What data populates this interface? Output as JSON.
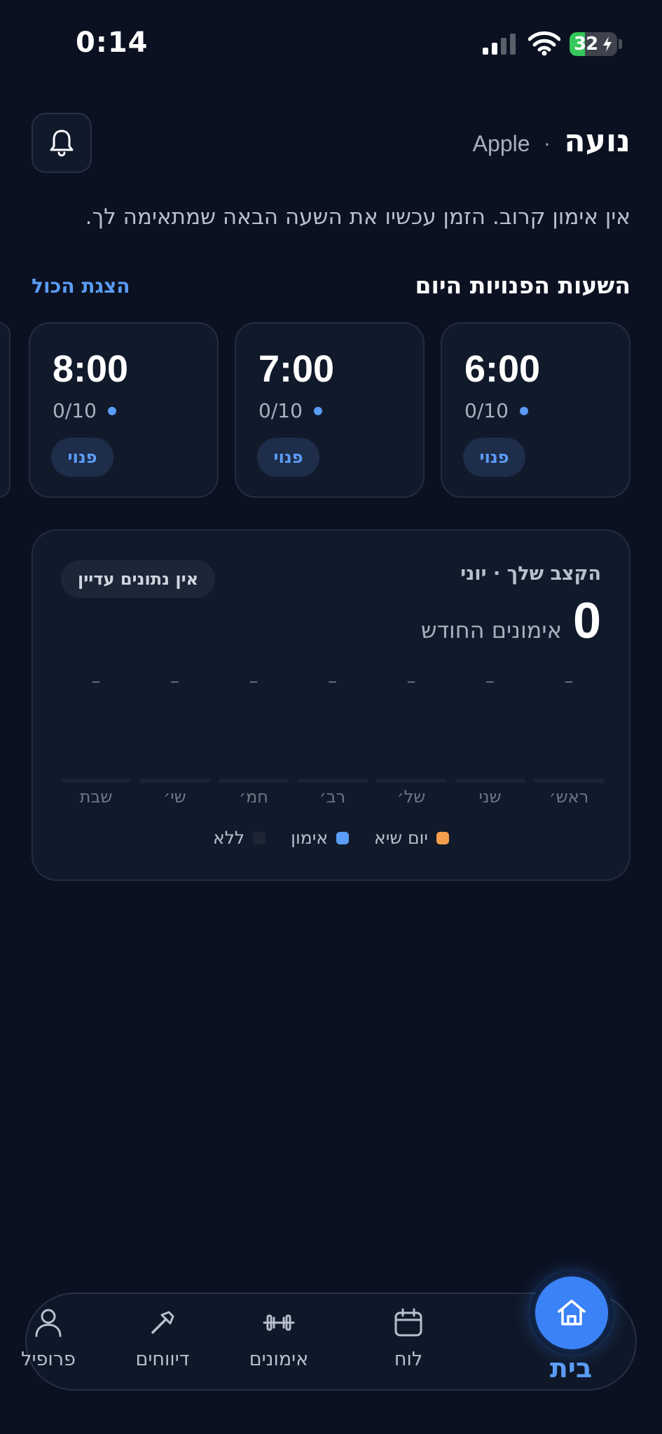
{
  "status_bar": {
    "time": "0:14",
    "battery_level": "32",
    "battery_color": "#34c759",
    "icons": [
      "signal-icon",
      "wifi-icon",
      "battery-charging-icon"
    ]
  },
  "header": {
    "user_name": "נועה",
    "separator": "·",
    "brand": "Apple",
    "bell_icon": "bell-icon",
    "subtitle": "אין אימון קרוב. הזמן עכשיו את השעה הבאה שמתאימה לך."
  },
  "free_slots": {
    "title": "השעות הפנויות היום",
    "show_all_label": "הצגת הכול",
    "items": [
      {
        "time": "6:00",
        "capacity": "0/10",
        "status": "פנוי"
      },
      {
        "time": "7:00",
        "capacity": "0/10",
        "status": "פנוי"
      },
      {
        "time": "8:00",
        "capacity": "0/10",
        "status": "פנוי"
      }
    ]
  },
  "pace": {
    "title": "הקצב שלך · יוני",
    "count": "0",
    "count_label": "אימונים החודש",
    "no_data_label": "אין נתונים עדיין",
    "chart_data": {
      "type": "bar",
      "categories": [
        "ראש׳",
        "שני",
        "של׳",
        "רב׳",
        "חמ׳",
        "שי׳",
        "שבת"
      ],
      "values": [
        "–",
        "–",
        "–",
        "–",
        "–",
        "–",
        "–"
      ]
    },
    "legend": [
      {
        "label": "יום שיא",
        "color": "#f59e4b"
      },
      {
        "label": "אימון",
        "color": "#5b9cf6"
      },
      {
        "label": "ללא",
        "color": "#1e2535"
      }
    ]
  },
  "nav": {
    "home": "בית",
    "schedule": "לוח",
    "workouts": "אימונים",
    "reports": "דיווחים",
    "profile": "פרופיל",
    "accent_color": "#3b82f6"
  }
}
